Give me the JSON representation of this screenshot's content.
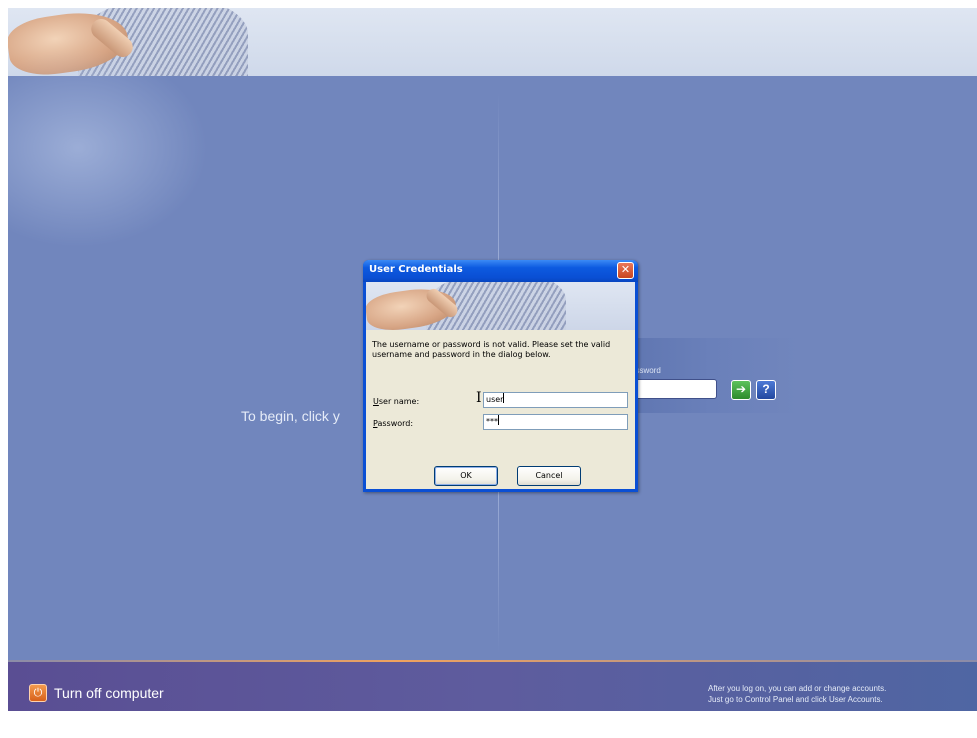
{
  "welcome": {
    "text": "To begin, click y"
  },
  "user_tile": {
    "password_label": "assword",
    "password_value": "",
    "go_symbol": "➔",
    "help_symbol": "?"
  },
  "footer": {
    "turn_off_label": "Turn off computer",
    "power_symbol": "⏻",
    "hint_line1": "After you log on, you can add or change accounts.",
    "hint_line2": "Just go to Control Panel and click User Accounts."
  },
  "dialog": {
    "title": "User Credentials",
    "close_symbol": "✕",
    "message": "The username or password is not valid. Please set the valid username and password in the dialog below.",
    "username_label_key": "U",
    "username_label_rest": "ser name:",
    "password_label_key": "P",
    "password_label_rest": "assword:",
    "username_value": "user",
    "password_value": "***",
    "ok_label": "OK",
    "cancel_label": "Cancel"
  },
  "colors": {
    "background": "#7186bd",
    "title_bar": "#0a4fd4",
    "dialog_face": "#ece9d8",
    "accent_orange": "#f0a25e"
  },
  "icons": {
    "power": "power-icon",
    "go": "arrow-right-icon",
    "help": "help-icon",
    "close": "close-icon",
    "cursor": "text-cursor-icon"
  }
}
